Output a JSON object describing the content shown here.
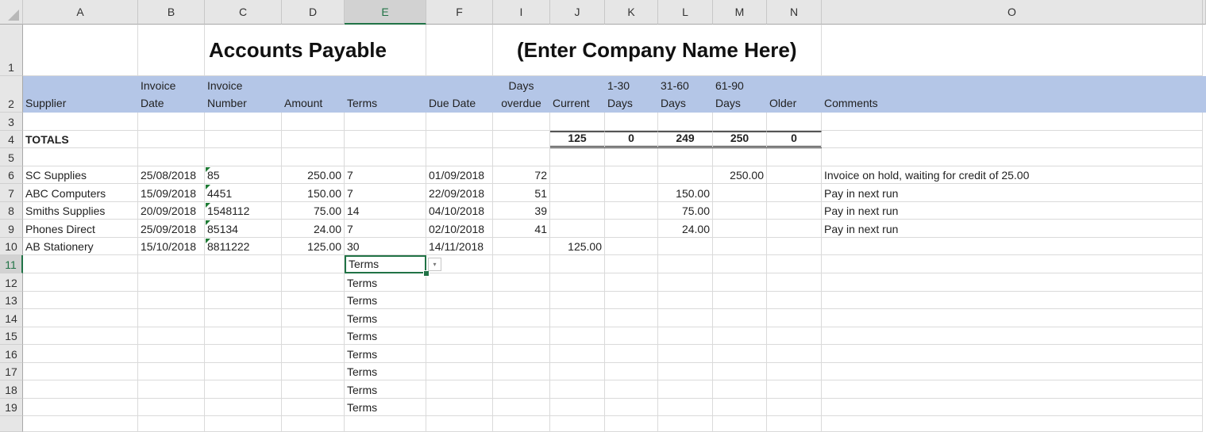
{
  "app": "Spreadsheet",
  "columns": [
    "A",
    "B",
    "C",
    "D",
    "E",
    "F",
    "I",
    "J",
    "K",
    "L",
    "M",
    "N",
    "O"
  ],
  "selected_column": "E",
  "selected_row": "11",
  "rows": [
    "1",
    "2",
    "3",
    "4",
    "5",
    "6",
    "7",
    "8",
    "9",
    "10",
    "11",
    "12",
    "13",
    "14",
    "15",
    "16",
    "17",
    "18",
    "19"
  ],
  "title": "Accounts Payable",
  "company": "(Enter Company Name Here)",
  "headers": {
    "supplier": [
      "",
      "Supplier"
    ],
    "invoice_date": [
      "Invoice",
      "Date"
    ],
    "invoice_number": [
      "Invoice",
      "Number"
    ],
    "amount": [
      "",
      "Amount"
    ],
    "terms": [
      "",
      "Terms"
    ],
    "due_date": [
      "",
      "Due Date"
    ],
    "days_overdue": [
      "Days",
      "overdue"
    ],
    "current": [
      "",
      "Current"
    ],
    "d1_30": [
      "1-30",
      "Days"
    ],
    "d31_60": [
      "31-60",
      "Days"
    ],
    "d61_90": [
      "61-90",
      "Days"
    ],
    "older": [
      "",
      "Older"
    ],
    "comments": [
      "",
      "Comments"
    ]
  },
  "totals": {
    "label": "TOTALS",
    "current": "125",
    "d1_30": "0",
    "d31_60": "249",
    "d61_90": "250",
    "older": "0"
  },
  "invoices": [
    {
      "supplier": "SC Supplies",
      "invoice_date": "25/08/2018",
      "invoice_number": "85",
      "amount": "250.00",
      "terms": "7",
      "due_date": "01/09/2018",
      "days_overdue": "72",
      "current": "",
      "d1_30": "",
      "d31_60": "",
      "d61_90": "250.00",
      "older": "",
      "comments": "Invoice on hold, waiting for credit of 25.00"
    },
    {
      "supplier": "ABC Computers",
      "invoice_date": "15/09/2018",
      "invoice_number": "4451",
      "amount": "150.00",
      "terms": "7",
      "due_date": "22/09/2018",
      "days_overdue": "51",
      "current": "",
      "d1_30": "",
      "d31_60": "150.00",
      "d61_90": "",
      "older": "",
      "comments": "Pay in next run"
    },
    {
      "supplier": "Smiths Supplies",
      "invoice_date": "20/09/2018",
      "invoice_number": "1548112",
      "amount": "75.00",
      "terms": "14",
      "due_date": "04/10/2018",
      "days_overdue": "39",
      "current": "",
      "d1_30": "",
      "d31_60": "75.00",
      "d61_90": "",
      "older": "",
      "comments": "Pay in next run"
    },
    {
      "supplier": "Phones Direct",
      "invoice_date": "25/09/2018",
      "invoice_number": "85134",
      "amount": "24.00",
      "terms": "7",
      "due_date": "02/10/2018",
      "days_overdue": "41",
      "current": "",
      "d1_30": "",
      "d31_60": "24.00",
      "d61_90": "",
      "older": "",
      "comments": "Pay in next run"
    },
    {
      "supplier": "AB Stationery",
      "invoice_date": "15/10/2018",
      "invoice_number": "8811222",
      "amount": "125.00",
      "terms": "30",
      "due_date": "14/11/2018",
      "days_overdue": "",
      "current": "125.00",
      "d1_30": "",
      "d31_60": "",
      "d61_90": "",
      "older": "",
      "comments": ""
    }
  ],
  "terms_placeholder_rows": [
    "Terms",
    "Terms",
    "Terms",
    "Terms",
    "Terms",
    "Terms",
    "Terms",
    "Terms",
    "Terms"
  ],
  "dropdown_icon": "chevron-down-icon"
}
